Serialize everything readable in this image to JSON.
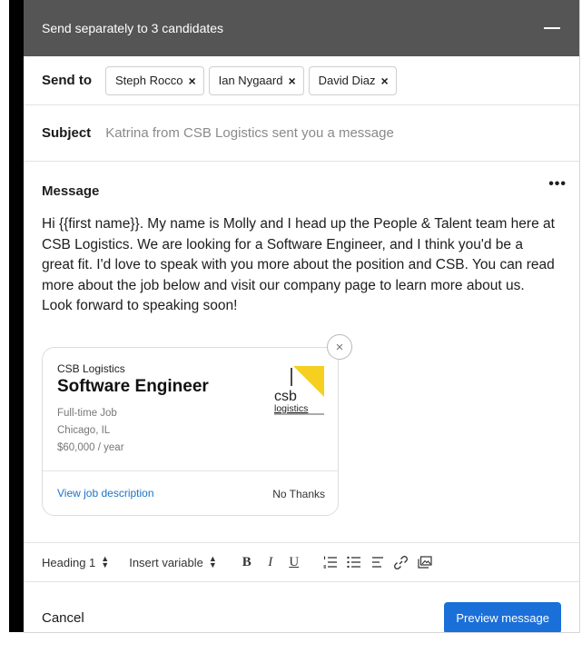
{
  "dialog": {
    "title": "Send separately to 3 candidates"
  },
  "send_to": {
    "label": "Send to",
    "recipients": [
      "Steph Rocco",
      "Ian Nygaard",
      "David Diaz"
    ],
    "remove_icon": "×"
  },
  "subject": {
    "label": "Subject",
    "value": "Katrina from CSB Logistics sent you a message"
  },
  "message": {
    "label": "Message",
    "more_icon": "•••",
    "body": "Hi {{first name}}. My name is Molly and I head up the People & Talent team here at CSB Logistics. We are looking for a Software Engineer, and I think you'd be a great fit. I'd love to speak with you more about the position and CSB. You can read more about the job below and visit our company page to learn more about us. Look forward to speaking soon!"
  },
  "job_card": {
    "company": "CSB Logistics",
    "title": "Software Engineer",
    "type": "Full-time Job",
    "location": "Chicago, IL",
    "salary": "$60,000 / year",
    "link": "View job description",
    "dismiss": "No Thanks",
    "close_icon": "×",
    "logo_text_top": "csb",
    "logo_text_bottom": "logistics",
    "logo_accent": "#f5d020"
  },
  "toolbar": {
    "heading_select": "Heading 1",
    "variable_select": "Insert variable",
    "bold": "B",
    "italic": "I",
    "underline": "U"
  },
  "footer": {
    "cancel": "Cancel",
    "preview": "Preview message"
  },
  "colors": {
    "titlebar": "#555555",
    "primary": "#1a6fd9",
    "link": "#1a73c8"
  }
}
